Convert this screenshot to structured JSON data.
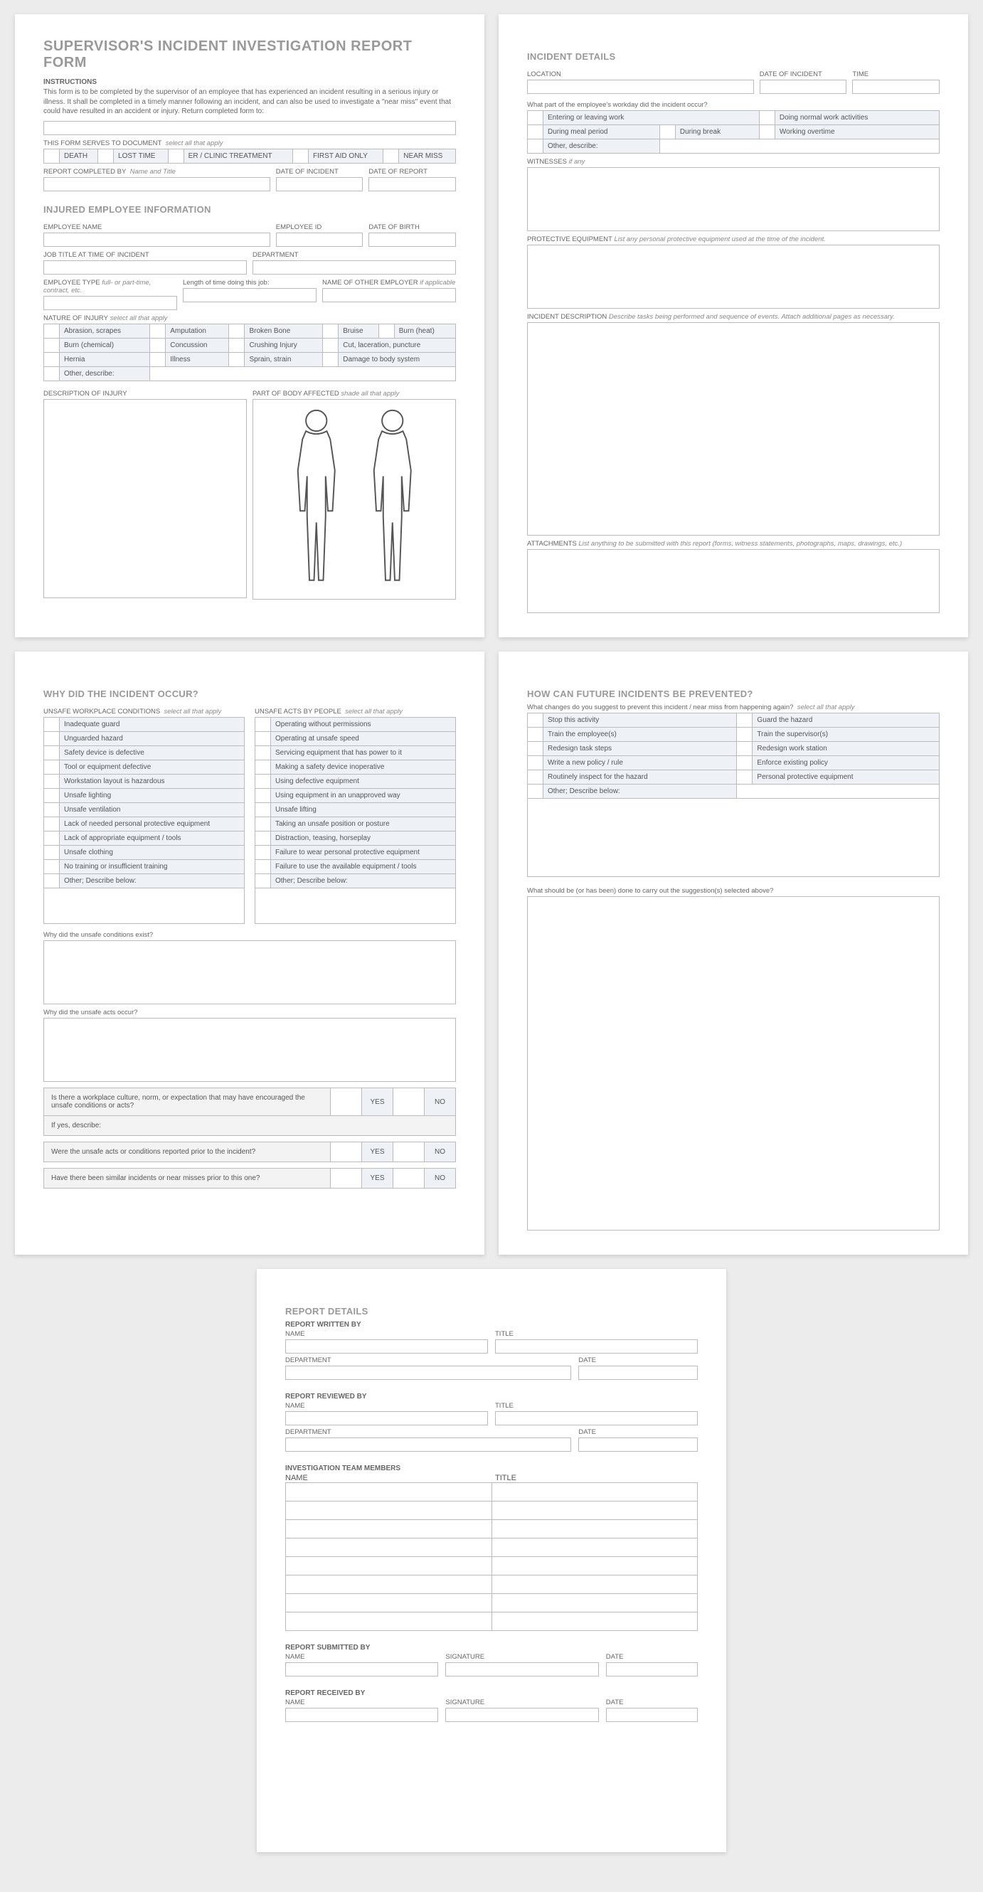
{
  "title": "SUPERVISOR'S INCIDENT INVESTIGATION REPORT FORM",
  "instructions": {
    "head": "INSTRUCTIONS",
    "body": "This form is to be completed by the supervisor of an employee that has experienced an incident resulting in a serious injury or illness. It shall be completed in a timely manner following an incident, and can also be used to investigate a \"near miss\" event that could have resulted in an accident or injury. Return completed form to:"
  },
  "formServes": {
    "label": "THIS FORM SERVES TO DOCUMENT",
    "hint": "select all that apply",
    "opts": [
      "DEATH",
      "LOST TIME",
      "ER / CLINIC TREATMENT",
      "FIRST AID ONLY",
      "NEAR MISS"
    ]
  },
  "reportCompletedBy": {
    "label": "REPORT COMPLETED BY",
    "hint": "Name and Title"
  },
  "dateOfIncident": "DATE OF INCIDENT",
  "dateOfReport": "DATE OF REPORT",
  "injured": {
    "section": "INJURED EMPLOYEE INFORMATION",
    "name": "EMPLOYEE NAME",
    "id": "EMPLOYEE ID",
    "dob": "DATE OF BIRTH",
    "jobTitle": "JOB TITLE AT TIME OF INCIDENT",
    "department": "DEPARTMENT",
    "empType": {
      "label": "EMPLOYEE TYPE",
      "hint": "full- or part-time, contract, etc."
    },
    "length": "Length of time doing this job:",
    "otherEmp": {
      "label": "NAME OF OTHER EMPLOYER",
      "hint": "if applicable"
    }
  },
  "nature": {
    "label": "NATURE OF INJURY",
    "hint": "select all that apply",
    "rows": [
      [
        "Abrasion, scrapes",
        "Amputation",
        "Broken Bone",
        "Bruise",
        "Burn (heat)"
      ],
      [
        "Burn (chemical)",
        "Concussion",
        "Crushing Injury",
        "Cut, laceration, puncture"
      ],
      [
        "Hernia",
        "Illness",
        "Sprain, strain",
        "Damage to body system"
      ]
    ],
    "other": "Other, describe:"
  },
  "descInjury": "DESCRIPTION OF INJURY",
  "partBody": {
    "label": "PART OF BODY AFFECTED",
    "hint": "shade all that apply"
  },
  "incident": {
    "section": "INCIDENT DETAILS",
    "location": "LOCATION",
    "date": "DATE OF INCIDENT",
    "time": "TIME",
    "workdayQ": "What part of the employee's workday did the incident occur?",
    "workdayOpts": [
      [
        "Entering or leaving work",
        "Doing normal work activities"
      ],
      [
        "During meal period",
        "During break",
        "Working overtime"
      ]
    ],
    "workdayOther": "Other, describe:",
    "witnesses": {
      "label": "WITNESSES",
      "hint": "if any"
    },
    "ppe": {
      "label": "PROTECTIVE EQUIPMENT",
      "hint": "List any personal protective equipment used at the time of the incident."
    },
    "desc": {
      "label": "INCIDENT DESCRIPTION",
      "hint": "Describe tasks being performed and sequence of events.  Attach additional pages as necessary."
    },
    "attach": {
      "label": "ATTACHMENTS",
      "hint": "List anything to be submitted with this report (forms, witness statements, photographs, maps, drawings, etc.)"
    }
  },
  "why": {
    "section": "WHY DID THE INCIDENT OCCUR?",
    "conditions": {
      "label": "UNSAFE WORKPLACE CONDITIONS",
      "hint": "select all that apply",
      "items": [
        "Inadequate guard",
        "Unguarded hazard",
        "Safety device is defective",
        "Tool or equipment defective",
        "Workstation layout is hazardous",
        "Unsafe lighting",
        "Unsafe ventilation",
        "Lack of needed personal protective equipment",
        "Lack of appropriate equipment / tools",
        "Unsafe clothing",
        "No training or insufficient training",
        "Other; Describe below:"
      ]
    },
    "acts": {
      "label": "UNSAFE ACTS BY PEOPLE",
      "hint": "select all that apply",
      "items": [
        "Operating without permissions",
        "Operating at unsafe speed",
        "Servicing equipment that has power to it",
        "Making a safety device inoperative",
        "Using defective equipment",
        "Using equipment in an unapproved way",
        "Unsafe lifting",
        "Taking an unsafe position or posture",
        "Distraction, teasing, horseplay",
        "Failure to wear personal protective equipment",
        "Failure to use the available equipment / tools",
        "Other; Describe below:"
      ]
    },
    "q1": "Why did the unsafe conditions exist?",
    "q2": "Why did the unsafe acts occur?",
    "culture": "Is there a workplace culture, norm, or expectation that may have encouraged the unsafe conditions or acts?",
    "ifyes": "If yes, describe:",
    "reported": "Were the unsafe acts or conditions reported prior to the incident?",
    "similar": "Have there been similar incidents or near misses prior to this one?",
    "yes": "YES",
    "no": "NO"
  },
  "prevent": {
    "section": "HOW CAN FUTURE INCIDENTS BE PREVENTED?",
    "q": "What changes do you suggest to prevent this incident / near miss from happening again?",
    "hint": "select all that apply",
    "rows": [
      [
        "Stop this activity",
        "Guard the hazard"
      ],
      [
        "Train the employee(s)",
        "Train the supervisor(s)"
      ],
      [
        "Redesign task steps",
        "Redesign work station"
      ],
      [
        "Write a new policy / rule",
        "Enforce existing policy"
      ],
      [
        "Routinely inspect for the hazard",
        "Personal protective equipment"
      ]
    ],
    "other": "Other; Describe below:",
    "carry": "What should be (or has been) done to carry out the suggestion(s) selected above?"
  },
  "details": {
    "section": "REPORT DETAILS",
    "writtenBy": "REPORT WRITTEN BY",
    "reviewedBy": "REPORT REVIEWED BY",
    "team": "INVESTIGATION TEAM MEMBERS",
    "submittedBy": "REPORT SUBMITTED BY",
    "receivedBy": "REPORT RECEIVED BY",
    "name": "NAME",
    "title": "TITLE",
    "department": "DEPARTMENT",
    "date": "DATE",
    "signature": "SIGNATURE"
  }
}
